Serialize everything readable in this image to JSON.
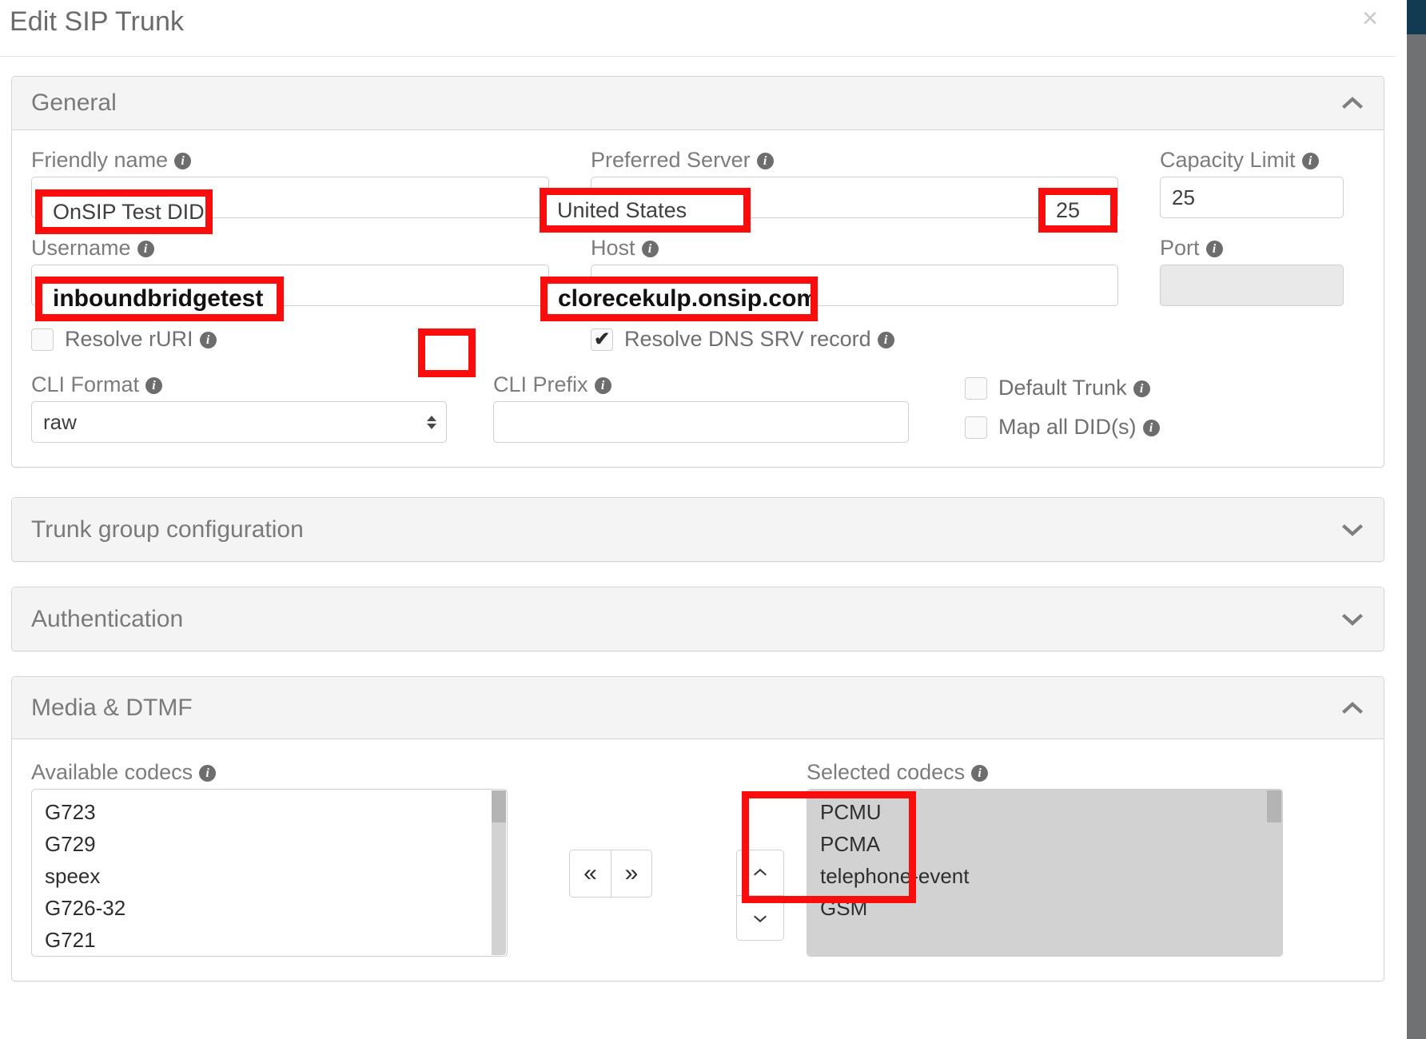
{
  "window": {
    "title": "Edit SIP Trunk",
    "close_icon": "close-icon",
    "close_glyph": "×"
  },
  "sections": [
    {
      "id": "general",
      "title": "General",
      "expanded": true,
      "chevron": "chevron-up-icon"
    },
    {
      "id": "trunk-group-configuration",
      "title": "Trunk group configuration",
      "expanded": false,
      "chevron": "chevron-down-icon"
    },
    {
      "id": "authentication",
      "title": "Authentication",
      "expanded": false,
      "chevron": "chevron-down-icon"
    },
    {
      "id": "media-dtmf",
      "title": "Media & DTMF",
      "expanded": true,
      "chevron": "chevron-up-icon"
    }
  ],
  "general": {
    "friendly_name": {
      "label": "Friendly name",
      "value": "OnSIP Test DID",
      "placeholder": ""
    },
    "preferred_server": {
      "label": "Preferred Server",
      "value": "United States",
      "options": [
        "United States"
      ]
    },
    "capacity_limit": {
      "label": "Capacity Limit",
      "value": "25",
      "placeholder": ""
    },
    "username": {
      "label": "Username",
      "value": "inboundbridgetest",
      "placeholder": ""
    },
    "host": {
      "label": "Host",
      "value": "clorecekulp.onsip.com",
      "placeholder": ""
    },
    "port": {
      "label": "Port",
      "value": "",
      "placeholder": "",
      "disabled": true
    },
    "resolve_ruri": {
      "label": "Resolve rURI",
      "checked": false
    },
    "resolve_dns_srv": {
      "label": "Resolve DNS SRV record",
      "checked": true,
      "check_glyph": "✔"
    },
    "cli_format": {
      "label": "CLI Format",
      "value": "raw",
      "options": [
        "raw"
      ]
    },
    "cli_prefix": {
      "label": "CLI Prefix",
      "value": "",
      "placeholder": ""
    },
    "default_trunk": {
      "label": "Default Trunk",
      "checked": false
    },
    "map_all_dids": {
      "label": "Map all DID(s)",
      "checked": false
    },
    "info_icon": "info-icon"
  },
  "media": {
    "available_codecs": {
      "label": "Available codecs",
      "items": [
        "G723",
        "G729",
        "speex",
        "G726-32",
        "G721"
      ]
    },
    "selected_codecs": {
      "label": "Selected codecs",
      "items": [
        "PCMU",
        "PCMA",
        "telephone-event",
        "GSM"
      ]
    },
    "transfer_buttons": [
      {
        "name": "move-left-button",
        "glyph": "«"
      },
      {
        "name": "move-right-button",
        "glyph": "»"
      }
    ],
    "reorder_buttons": [
      {
        "name": "move-up-button",
        "icon": "chevron-up-icon"
      },
      {
        "name": "move-down-button",
        "icon": "chevron-down-icon"
      }
    ]
  },
  "annotations": {
    "color": "#fb0d0d",
    "boxes": [
      {
        "name": "annotation-friendly-name",
        "text": "OnSIP Test DID",
        "bold": false
      },
      {
        "name": "annotation-preferred-server",
        "text": "United States",
        "bold": false
      },
      {
        "name": "annotation-capacity-limit",
        "text": "25",
        "bold": false
      },
      {
        "name": "annotation-username",
        "text": "inboundbridgetest",
        "bold": true
      },
      {
        "name": "annotation-host",
        "text": "clorecekulp.onsip.com",
        "bold": true
      },
      {
        "name": "annotation-resolve-dns-srv-checkbox",
        "text": "",
        "bold": false
      },
      {
        "name": "annotation-selected-codecs",
        "text": "",
        "bold": false
      }
    ]
  }
}
